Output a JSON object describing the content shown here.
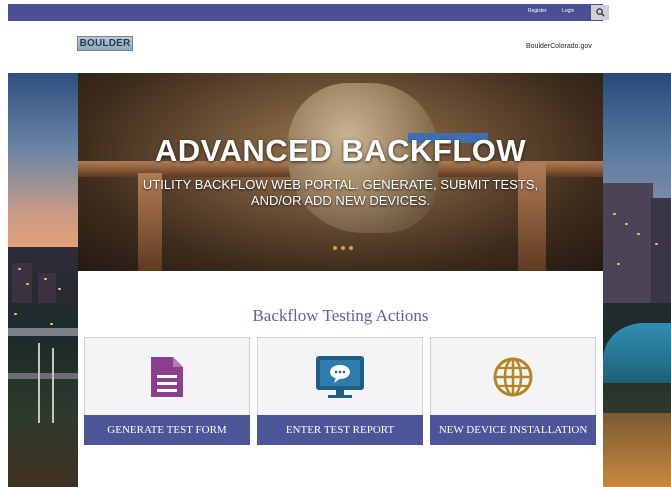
{
  "topbar": {
    "register_label": "Register",
    "login_label": "Login",
    "search_icon": "search-icon"
  },
  "header": {
    "logo_text": "BOULDER",
    "site_link": "BoulderColorado.gov"
  },
  "hero": {
    "title": "ADVANCED BACKFLOW",
    "subtitle_line1": "UTILITY BACKFLOW WEB PORTAL. GENERATE, SUBMIT TESTS,",
    "subtitle_line2": "AND/OR ADD NEW DEVICES."
  },
  "actions": {
    "title": "Backflow Testing Actions",
    "cards": [
      {
        "label": "GENERATE TEST FORM",
        "icon": "document-icon",
        "icon_color": "#8b3f8f"
      },
      {
        "label": "ENTER TEST REPORT",
        "icon": "monitor-chat-icon",
        "icon_color": "#1f5f86"
      },
      {
        "label": "NEW DEVICE INSTALLATION",
        "icon": "globe-icon",
        "icon_color": "#b58622"
      }
    ]
  },
  "colors": {
    "nav_bar": "#4b4f94",
    "card_bar": "#4b5598",
    "section_title": "#5964a3"
  }
}
